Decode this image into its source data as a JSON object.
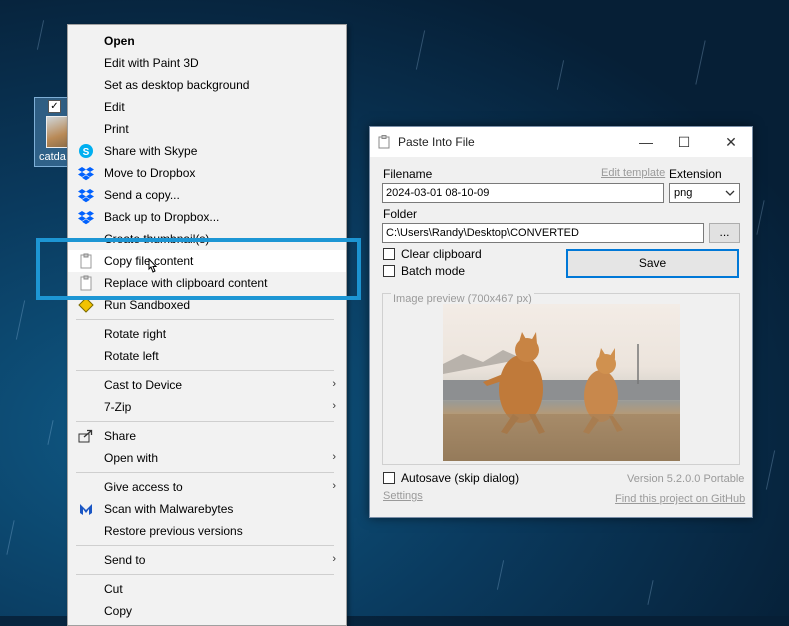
{
  "desktop": {
    "icon_label": "catda"
  },
  "context_menu": {
    "items": [
      {
        "label": "Open",
        "bold": true,
        "icon": ""
      },
      {
        "label": "Edit with Paint 3D",
        "icon": ""
      },
      {
        "label": "Set as desktop background",
        "icon": ""
      },
      {
        "label": "Edit",
        "icon": ""
      },
      {
        "label": "Print",
        "icon": ""
      },
      {
        "label": "Share with Skype",
        "icon": "skype-icon"
      },
      {
        "label": "Move to Dropbox",
        "icon": "dropbox-icon"
      },
      {
        "label": "Send a copy...",
        "icon": "dropbox-icon"
      },
      {
        "label": "Back up to Dropbox...",
        "icon": "dropbox-icon"
      },
      {
        "label": "Create thumbnail(s)",
        "icon": ""
      },
      {
        "label": "Copy file content",
        "icon": "paste-into-file-icon"
      },
      {
        "label": "Replace with clipboard content",
        "icon": "paste-into-file-icon"
      },
      {
        "label": "Run Sandboxed",
        "icon": "sandboxie-icon"
      },
      {
        "label": "Rotate right",
        "icon": ""
      },
      {
        "label": "Rotate left",
        "icon": ""
      },
      {
        "label": "Cast to Device",
        "icon": "",
        "submenu": true
      },
      {
        "label": "7-Zip",
        "icon": "",
        "submenu": true
      },
      {
        "label": "Share",
        "icon": "share-icon"
      },
      {
        "label": "Open with",
        "icon": "",
        "submenu": true
      },
      {
        "label": "Give access to",
        "icon": "",
        "submenu": true
      },
      {
        "label": "Scan with Malwarebytes",
        "icon": "malwarebytes-icon"
      },
      {
        "label": "Restore previous versions",
        "icon": ""
      },
      {
        "label": "Send to",
        "icon": "",
        "submenu": true
      },
      {
        "label": "Cut",
        "icon": ""
      },
      {
        "label": "Copy",
        "icon": ""
      }
    ],
    "submenu_glyph": "›"
  },
  "dialog": {
    "title": "Paste Into File",
    "minimize_glyph": "—",
    "maximize_glyph": "☐",
    "close_glyph": "✕",
    "filename_label": "Filename",
    "edit_template_link": "Edit template",
    "extension_label": "Extension",
    "filename_value": "2024-03-01 08-10-09",
    "extension_value": "png",
    "folder_label": "Folder",
    "folder_value": "C:\\Users\\Randy\\Desktop\\CONVERTED",
    "browse_label": "...",
    "clear_clipboard_label": "Clear clipboard",
    "clear_clipboard_checked": false,
    "batch_mode_label": "Batch mode",
    "batch_mode_checked": false,
    "save_label": "Save",
    "preview_label": "Image preview (700x467 px)",
    "autosave_label": "Autosave (skip dialog)",
    "autosave_checked": false,
    "version_text": "Version 5.2.0.0 Portable",
    "settings_link": "Settings",
    "github_link": "Find this project on GitHub"
  },
  "colors": {
    "highlight_box": "#1d96d4",
    "dropbox": "#0061fe",
    "skype": "#00aff0"
  }
}
